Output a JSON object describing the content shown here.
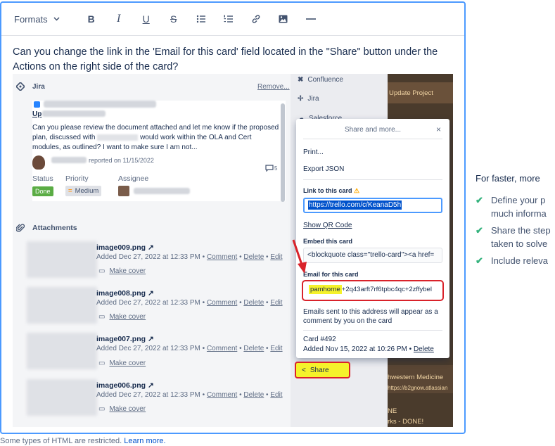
{
  "toolbar": {
    "formats_label": "Formats",
    "bold": "B",
    "italic": "I",
    "underline": "U",
    "strike": "S"
  },
  "question": "Can you change the link in the 'Email for this card' field located in the \"Share\" button under the Actions on the right side of the card?",
  "screenshot": {
    "jira_label": "Jira",
    "remove_label": "Remove...",
    "updated_label": "Up",
    "body_text_1": "Can you please review the document attached and let me know if the proposed",
    "body_text_2": "plan, discussed with",
    "body_text_2b": "would work within the OLA and Cert",
    "body_text_3": "modules, as outlined? I want to make sure I am not...",
    "reported_on": "reported on 11/15/2022",
    "comment_count": "5",
    "status_label": "Status",
    "priority_label": "Priority",
    "assignee_label": "Assignee",
    "status_value": "Done",
    "priority_value": "Medium",
    "attachments_label": "Attachments",
    "attachments": [
      {
        "name": "image009.png",
        "meta": "Added Dec 27, 2022 at 12:33 PM •",
        "comment": "Comment",
        "delete": "Delete",
        "edit": "Edit",
        "cover": "Make cover"
      },
      {
        "name": "image008.png",
        "meta": "Added Dec 27, 2022 at 12:33 PM •",
        "comment": "Comment",
        "delete": "Delete",
        "edit": "Edit",
        "cover": "Make cover"
      },
      {
        "name": "image007.png",
        "meta": "Added Dec 27, 2022 at 12:33 PM •",
        "comment": "Comment",
        "delete": "Delete",
        "edit": "Edit",
        "cover": "Make cover"
      },
      {
        "name": "image006.png",
        "meta": "Added Dec 27, 2022 at 12:33 PM •",
        "comment": "Comment",
        "delete": "Delete",
        "edit": "Edit",
        "cover": "Make cover"
      }
    ],
    "right_col": {
      "confluence": "Confluence",
      "jira": "Jira",
      "salesforce": "Salesforce"
    },
    "dark_texts": {
      "update_project": "Update Project",
      "northwestern": "hwestern Medicine",
      "url_snip": "https://b2gnow.atlassian",
      "ne": "NE",
      "works_done": "rks - DONE!"
    },
    "popover": {
      "title": "Share and more...",
      "close": "×",
      "print": "Print...",
      "export_json": "Export JSON",
      "link_label": "Link to this card",
      "link_value": "https://trello.com/c/KeanaD5h",
      "qr_label": "Show QR Code",
      "embed_label": "Embed this card",
      "embed_value": "<blockquote class=\"trello-card\"><a href=",
      "email_label": "Email for this card",
      "email_highlight": "pamhorne",
      "email_rest": "+2q43arft7rf6tpbc4qc+2zffybel",
      "email_note": "Emails sent to this address will appear as a comment by you on the card",
      "card_number": "Card #492",
      "card_added": "Added Nov 15, 2022 at 10:26 PM •",
      "card_delete": "Delete"
    },
    "share_label": "Share"
  },
  "right_panel": {
    "title": "For faster, more",
    "items": [
      "Define your p much informa",
      "Share the step taken to solve",
      "Include releva"
    ]
  },
  "footer": {
    "text": "Some types of HTML are restricted.",
    "link": "Learn more."
  },
  "colors": {
    "accent": "#4c9aff",
    "highlight": "#f5f22b",
    "annotation_red": "#d9222a",
    "done_green": "#5aac44",
    "check_green": "#36b37e"
  }
}
